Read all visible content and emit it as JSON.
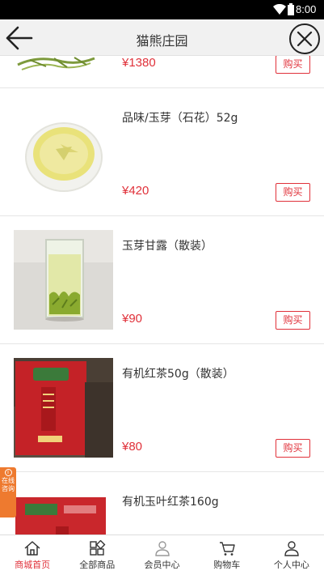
{
  "status_bar": {
    "time": "8:00"
  },
  "header": {
    "title": "猫熊庄园"
  },
  "products": [
    {
      "name": "",
      "price": "¥1380",
      "buy_label": "购买"
    },
    {
      "name": "品味/玉芽（石花）52g",
      "price": "¥420",
      "buy_label": "购买"
    },
    {
      "name": "玉芽甘露（散装）",
      "price": "¥90",
      "buy_label": "购买"
    },
    {
      "name": "有机红茶50g（散装）",
      "price": "¥80",
      "buy_label": "购买"
    },
    {
      "name": "有机玉叶红茶160g",
      "price": "",
      "buy_label": ""
    }
  ],
  "side_tab": {
    "label": "在线咨询"
  },
  "bottom_nav": [
    {
      "label": "商城首页",
      "icon": "home-icon",
      "active": true
    },
    {
      "label": "全部商品",
      "icon": "grid-icon",
      "active": false
    },
    {
      "label": "会员中心",
      "icon": "member-icon",
      "active": false
    },
    {
      "label": "购物车",
      "icon": "cart-icon",
      "active": false
    },
    {
      "label": "个人中心",
      "icon": "user-icon",
      "active": false
    }
  ],
  "colors": {
    "accent": "#e0313a",
    "side_tab": "#ee7a2f",
    "header_bg": "#f1f1f1"
  }
}
